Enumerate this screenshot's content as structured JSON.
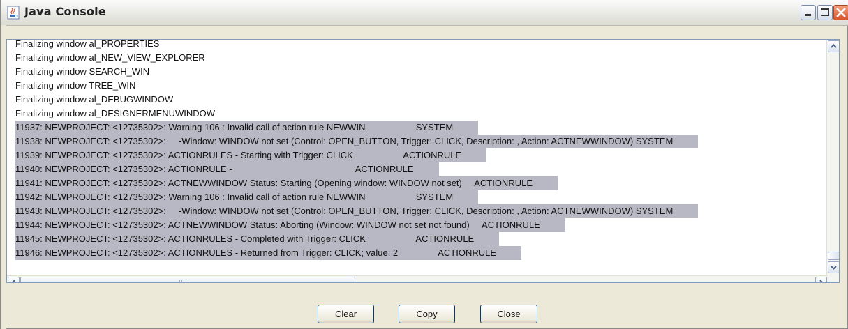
{
  "window": {
    "title": "Java Console"
  },
  "console": {
    "lines": [
      "Finalizing window al_PROPERTIES",
      "Finalizing window al_NEW_VIEW_EXPLORER",
      "Finalizing window SEARCH_WIN",
      "Finalizing window TREE_WIN",
      "Finalizing window al_DEBUGWINDOW",
      "Finalizing window al_DESIGNERMENUWINDOW",
      "11937: NEWPROJECT: <12735302>: Warning 106 : Invalid call of action rule NEWWIN                    SYSTEM",
      "11938: NEWPROJECT: <12735302>:     -Window: WINDOW not set (Control: OPEN_BUTTON, Trigger: CLICK, Description: , Action: ACTNEWWINDOW) SYSTEM",
      "11939: NEWPROJECT: <12735302>: ACTIONRULES - Starting with Trigger: CLICK                    ACTIONRULE",
      "11940: NEWPROJECT: <12735302>: ACTIONRULE -                                                 ACTIONRULE",
      "11941: NEWPROJECT: <12735302>: ACTNEWWINDOW Status: Starting (Opening window: WINDOW not set)     ACTIONRULE",
      "11942: NEWPROJECT: <12735302>: Warning 106 : Invalid call of action rule NEWWIN                    SYSTEM",
      "11943: NEWPROJECT: <12735302>:     -Window: WINDOW not set (Control: OPEN_BUTTON, Trigger: CLICK, Description: , Action: ACTNEWWINDOW) SYSTEM",
      "11944: NEWPROJECT: <12735302>: ACTNEWWINDOW Status: Aborting (Window: WINDOW not set not found)     ACTIONRULE",
      "11945: NEWPROJECT: <12735302>: ACTIONRULES - Completed with Trigger: CLICK                    ACTIONRULE",
      "11946: NEWPROJECT: <12735302>: ACTIONRULES - Returned from Trigger: CLICK; value: 2                ACTIONRULE"
    ]
  },
  "buttons": {
    "clear": "Clear",
    "copy": "Copy",
    "close": "Close"
  },
  "icons": {
    "app": "java-cup-icon",
    "minimize": "minimize-icon",
    "maximize": "maximize-icon",
    "close": "close-icon"
  },
  "colors": {
    "selection": "#b8b8c4",
    "close_button": "#d8542a",
    "border_accent": "#7f9db9"
  }
}
